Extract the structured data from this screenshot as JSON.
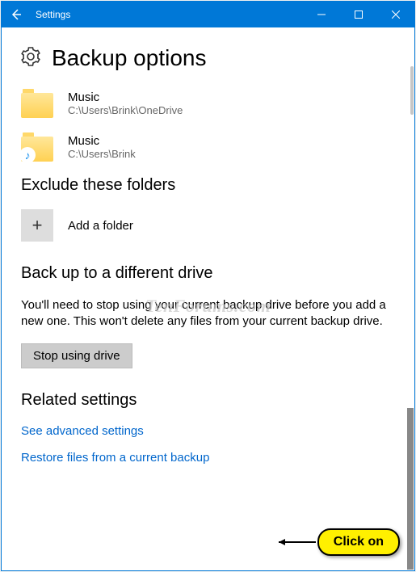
{
  "window": {
    "title": "Settings"
  },
  "page": {
    "heading": "Backup options"
  },
  "folders": [
    {
      "name": "Music",
      "path": "C:\\Users\\Brink\\OneDrive",
      "hasNote": false
    },
    {
      "name": "Music",
      "path": "C:\\Users\\Brink",
      "hasNote": true
    }
  ],
  "exclude": {
    "heading": "Exclude these folders",
    "add_label": "Add a folder"
  },
  "backup_drive": {
    "heading": "Back up to a different drive",
    "description": "You'll need to stop using your current backup drive before you add a new one. This won't delete any files from your current backup drive.",
    "stop_label": "Stop using drive"
  },
  "related": {
    "heading": "Related settings",
    "advanced_link": "See advanced settings",
    "restore_link": "Restore files from a current backup"
  },
  "watermark": "TenForums.com",
  "callout": {
    "label": "Click on"
  }
}
